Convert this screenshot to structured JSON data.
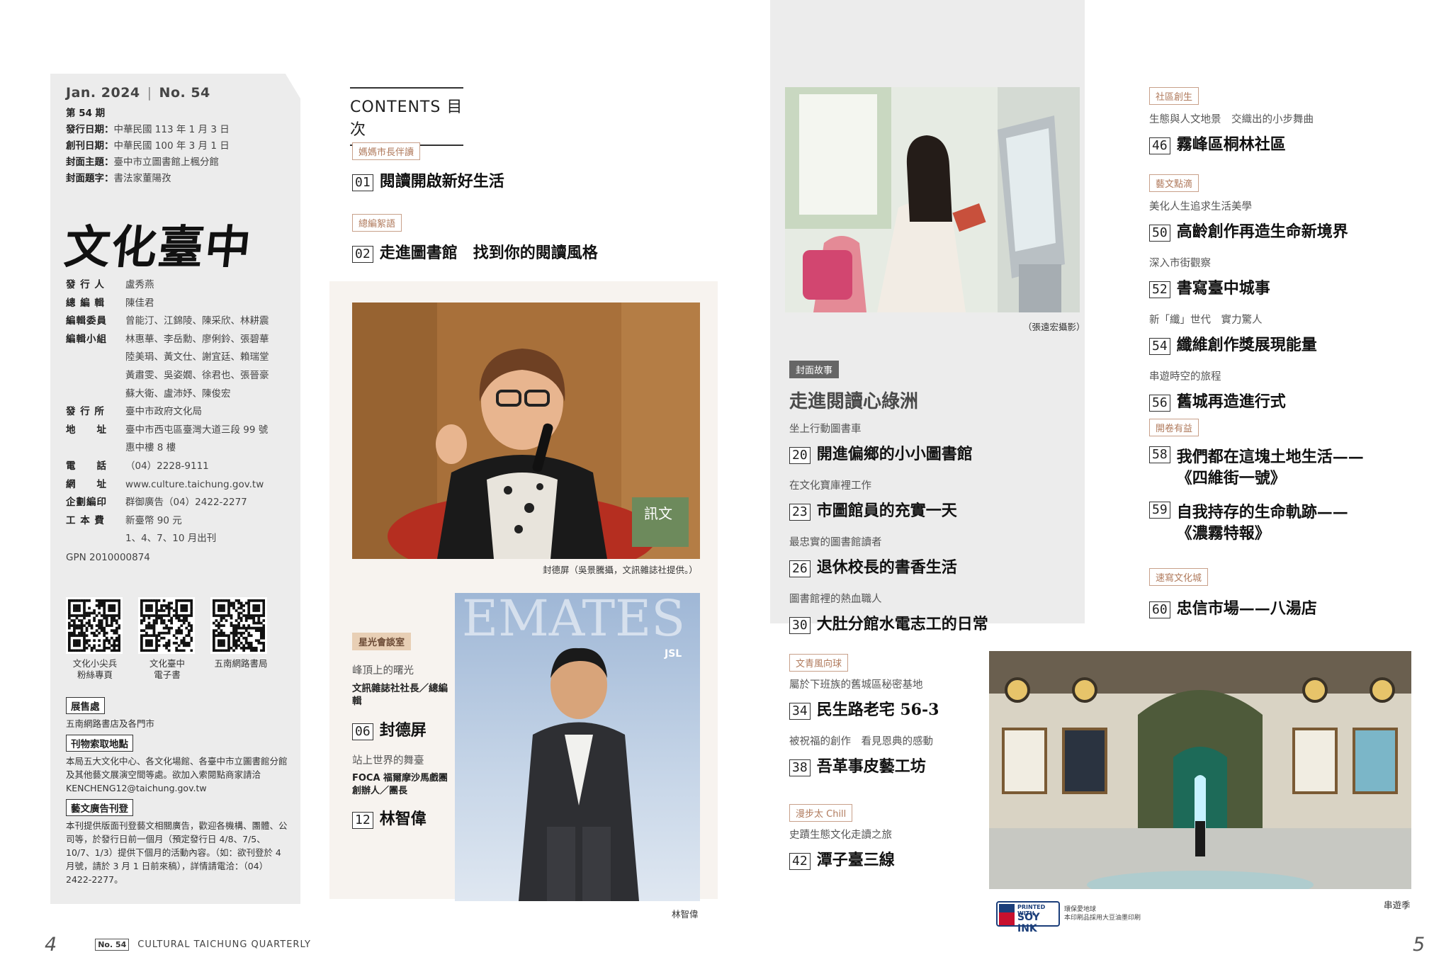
{
  "colophon": {
    "issue": "Jan. 2024",
    "issue_no": "No. 54",
    "period": "第 54 期",
    "rows": [
      {
        "k": "發行日期：",
        "v": "中華民國 113 年 1 月 3 日"
      },
      {
        "k": "創刊日期：",
        "v": "中華民國 100 年 3 月 1 日"
      },
      {
        "k": "封面主題：",
        "v": "臺中市立圖書館上楓分館"
      },
      {
        "k": "封面題字：",
        "v": "書法家董陽孜"
      }
    ],
    "logo": "文化臺中",
    "staff": [
      {
        "k": "發 行 人",
        "v": "盧秀燕"
      },
      {
        "k": "總 編 輯",
        "v": "陳佳君"
      },
      {
        "k": "編輯委員",
        "v": "曾能汀、江錦陵、陳采欣、林耕震"
      },
      {
        "k": "編輯小組",
        "v": "林惠華、李岳勳、廖俐鈴、張碧華"
      },
      {
        "k": "",
        "v": "陸美琄、黃文仕、謝宜廷、賴瑞堂"
      },
      {
        "k": "",
        "v": "黃肅雯、吳姿嫺、徐君也、張晉豪"
      },
      {
        "k": "",
        "v": "蘇大衛、盧沛妤、陳俊宏"
      },
      {
        "k": "發 行 所",
        "v": "臺中市政府文化局"
      },
      {
        "k": "地　　址",
        "v": "臺中市西屯區臺灣大道三段 99 號"
      },
      {
        "k": "",
        "v": "惠中樓 8 樓"
      },
      {
        "k": "電　　話",
        "v": "（04）2228-9111"
      },
      {
        "k": "網　　址",
        "v": "www.culture.taichung.gov.tw"
      },
      {
        "k": "企劃編印",
        "v": "群御廣告（04）2422-2277"
      },
      {
        "k": "工 本 費",
        "v": "新臺幣 90 元"
      },
      {
        "k": "",
        "v": "1、4、7、10 月出刊"
      }
    ],
    "gpn": "GPN  2010000874",
    "qr": [
      {
        "label1": "文化小尖兵",
        "label2": "粉絲專頁"
      },
      {
        "label1": "文化臺中",
        "label2": "電子書"
      },
      {
        "label1": "五南網路書局",
        "label2": ""
      }
    ],
    "sale_title": "展售處",
    "sale_text": "五南網路書店及各門市",
    "pickup_title": "刊物索取地點",
    "pickup_text": "本局五大文化中心、各文化場館、各臺中市立圖書館分館及其他藝文展演空間等處。欲加入索閱點商家請洽 KENCHENG12@taichung.gov.tw",
    "ad_title": "藝文廣告刊登",
    "ad_text": "本刊提供版面刊登藝文相關廣告，歡迎各機構、團體、公司等，於發行日前一個月（預定發行日 4/8、7/5、10/7、1/3）提供下個月的活動內容。（如：欲刊登於 4 月號，請於 3 月 1 日前來稿），詳情請電洽：（04）2422-2277。"
  },
  "contents": {
    "title": "CONTENTS 目次",
    "sec1_tag": "媽媽市長伴讀",
    "sec1_num": "01",
    "sec1_title": "閱讀開啟新好生活",
    "sec2_tag": "總編絮語",
    "sec2_num": "02",
    "sec2_title": "走進圖書館　找到你的閱讀風格",
    "photo1_caption": "封德屏（吳景騰攝，文訊雜誌社提供。）",
    "photo2_caption": "林智偉",
    "photo2_sign": "EMATES",
    "sec3_tag": "星光會談室",
    "sec3_kicker1": "峰頂上的曙光",
    "sec3_role1": "文訊雜誌社社長／總編輯",
    "sec3_num1": "06",
    "sec3_name1": "封德屏",
    "sec3_kicker2": "站上世界的舞臺",
    "sec3_role2": "FOCA 福爾摩沙馬戲團創辦人／團長",
    "sec3_num2": "12",
    "sec3_name2": "林智偉"
  },
  "cover": {
    "photo_caption": "（張遠宏攝影）",
    "tag": "封面故事",
    "title": "走進閱讀心綠洲",
    "items": [
      {
        "kicker": "坐上行動圖書車",
        "num": "20",
        "title": "開進偏鄉的小小圖書館"
      },
      {
        "kicker": "在文化寶庫裡工作",
        "num": "23",
        "title": "市圖館員的充實一天"
      },
      {
        "kicker": "最忠實的圖書館讀者",
        "num": "26",
        "title": "退休校長的書香生活"
      },
      {
        "kicker": "圖書館裡的熱血職人",
        "num": "30",
        "title": "大肚分館水電志工的日常"
      }
    ]
  },
  "youth": {
    "tag": "文青風向球",
    "kicker1": "屬於下班族的舊城區秘密基地",
    "num1": "34",
    "title1": "民生路老宅 56-3",
    "kicker2": "被祝福的創作　看見恩典的感動",
    "num2": "38",
    "title2": "吾革事皮藝工坊"
  },
  "chill": {
    "tag": "漫步太 Chill",
    "kicker": "史蹟生態文化走讀之旅",
    "num": "42",
    "title": "潭子臺三線"
  },
  "right": {
    "community_tag": "社區創生",
    "community_kicker": "生態與人文地景　交織出的小步舞曲",
    "community_num": "46",
    "community_title": "霧峰區桐林社區",
    "art_tag": "藝文點滴",
    "art_items": [
      {
        "kicker": "美化人生追求生活美學",
        "num": "50",
        "title": "高齡創作再造生命新境界"
      },
      {
        "kicker": "深入市街觀察",
        "num": "52",
        "title": "書寫臺中城事"
      },
      {
        "kicker": "新「纖」世代　實力驚人",
        "num": "54",
        "title": "纖維創作獎展現能量"
      },
      {
        "kicker": "串遊時空的旅程",
        "num": "56",
        "title": "舊城再造進行式"
      }
    ],
    "open_tag": "開卷有益",
    "open_num1": "58",
    "open_title1a": "我們都在這塊土地生活——",
    "open_title1b": "《四維街一號》",
    "open_num2": "59",
    "open_title2a": "自我持存的生命軌跡——",
    "open_title2b": "《濃霧特報》",
    "sketch_tag": "速寫文化城",
    "sketch_num": "60",
    "sketch_title": "忠信市場——八湯店"
  },
  "bottom_right": {
    "photo_caption": "串遊季",
    "soy_badge_top": "PRINTED WITH",
    "soy_badge": "SOY INK",
    "soy_text1": "環保愛地球",
    "soy_text2": "本印刷品採用大豆油墨印刷"
  },
  "footer": {
    "page_left": "4",
    "no_box_a": "No.",
    "no_box_b": "54",
    "label": "CULTURAL TAICHUNG QUARTERLY",
    "page_right": "5"
  }
}
